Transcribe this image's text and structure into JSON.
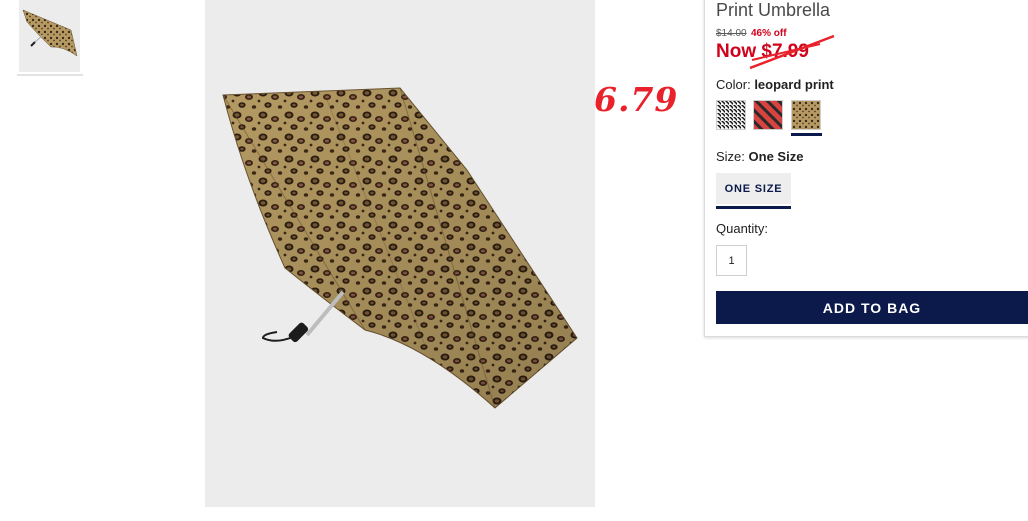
{
  "product": {
    "title": "Print Umbrella",
    "old_price": "$14.00",
    "discount": "46% off",
    "now_price": "Now $7.99",
    "color_label": "Color:",
    "color_value": "leopard print",
    "swatches": [
      {
        "name": "houndstooth"
      },
      {
        "name": "red-black-stripe"
      },
      {
        "name": "leopard-print",
        "selected": true
      }
    ],
    "size_label": "Size:",
    "size_value": "One Size",
    "size_button": "ONE SIZE",
    "quantity_label": "Quantity:",
    "quantity_value": "1",
    "add_to_bag": "ADD TO BAG"
  },
  "annotation": {
    "text": "6.79",
    "color": "#e8212b"
  },
  "colors": {
    "brand_navy": "#0b1a4a",
    "sale_red": "#d0021b"
  },
  "icons": {
    "thumbnail": "umbrella-thumbnail-icon",
    "main": "umbrella-product-image"
  }
}
